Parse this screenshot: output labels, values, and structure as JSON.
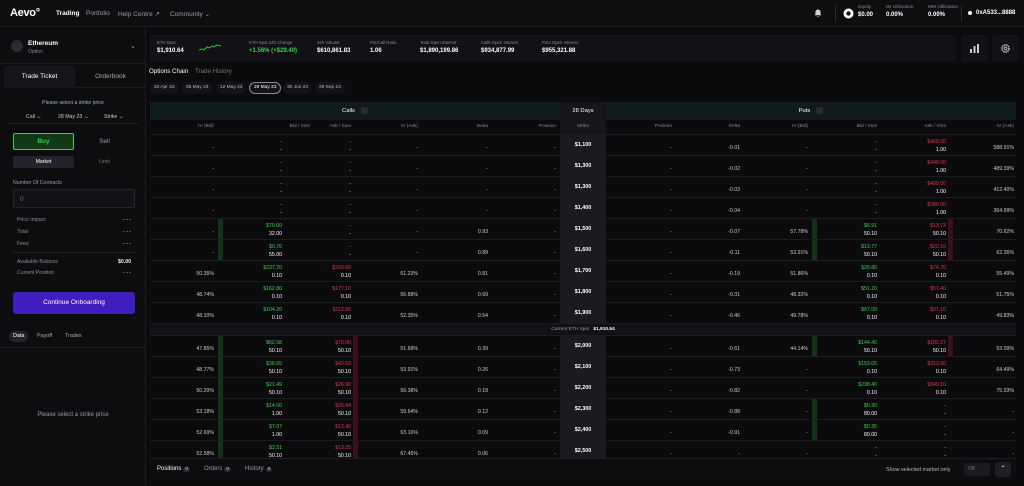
{
  "topnav": {
    "logo": "Aevo°",
    "items": [
      "Trading",
      "Portfolio",
      "Help Centre ↗",
      "Community ⌄"
    ],
    "equity_label": "Equity",
    "equity_value": "$0.00",
    "im_label": "IM Utilization",
    "im_value": "0.00%",
    "mm_label": "MM Utilization",
    "mm_value": "0.00%",
    "wallet": "0xA533...8888"
  },
  "sidebar": {
    "asset_name": "Ethereum",
    "asset_sub": "Option",
    "tab_trade": "Trade Ticket",
    "tab_orderbook": "Orderbook",
    "hint": "Please select a strike price",
    "opt_type": "Call ↔",
    "opt_date": "28 May 23 ↔",
    "opt_strike": "Strike ↔",
    "buy": "Buy",
    "sell": "Sell",
    "market": "Market",
    "limit": "Limit",
    "contracts_label": "Number Of Contracts",
    "contracts_placeholder": "0",
    "price_impact": "Price Impact",
    "price_impact_v": "- - -",
    "total": "Total",
    "total_v": "- - -",
    "fees": "Fees",
    "fees_v": "- - -",
    "avail": "Available Balance",
    "avail_v": "$0.00",
    "curpos": "Current Position",
    "curpos_v": "- - -",
    "cta": "Continue Onboarding",
    "btab1": "Data",
    "btab2": "Payoff",
    "btab3": "Trades",
    "empty": "Please select a strike price"
  },
  "market": {
    "spot_k": "ETH Spot",
    "spot_v": "$1,910.64",
    "chg_k": "ETH Spot 24h Change",
    "chg_v": "+1.56% (+$29.40)",
    "vol_k": "24h Volume",
    "vol_v": "$610,861.83",
    "pc_k": "Put/Call Ratio",
    "pc_v": "1.06",
    "oi_k": "Total Open Interest",
    "oi_v": "$1,890,199.86",
    "coi_k": "Calls Open Interest",
    "coi_v": "$934,877.99",
    "poi_k": "Puts Open Interest",
    "poi_v": "$955,321.88"
  },
  "subtabs": {
    "chain": "Options Chain",
    "history": "Trade History"
  },
  "dates": [
    "20 Apr 23",
    "05 May 23",
    "12 May 23",
    "28 May 23",
    "30 Jun 23",
    "29 Sep 23"
  ],
  "table": {
    "calls": "Calls",
    "days": "28 Days",
    "puts": "Puts",
    "call_cols": [
      "IV (Bid)",
      "Bid / Size",
      "Ask / Size",
      "IV (Ask)",
      "Delta",
      "Position"
    ],
    "strike_col": "Strike",
    "put_cols": [
      "Position",
      "Delta",
      "IV (Bid)",
      "Bid / Size",
      "Ask / Size",
      "IV (Ask)"
    ],
    "separator_label": "Current ETH Spot",
    "separator_value": "$1,910.64",
    "rows": [
      {
        "civb": "-",
        "cbid": "-",
        "cbsz": "-",
        "cask": "-",
        "casz": "-",
        "civa": "-",
        "cdel": "-",
        "cpos": "-",
        "strike": "$1,100",
        "ppos": "-",
        "pdel": "-0.01",
        "pivb": "-",
        "pbid": "-",
        "pbsz": "-",
        "pask": "$469.00",
        "pasz": "1.00",
        "piva": "588.91%"
      },
      {
        "civb": "-",
        "cbid": "-",
        "cbsz": "-",
        "cask": "-",
        "casz": "-",
        "civa": "-",
        "cdel": "-",
        "cpos": "-",
        "strike": "$1,300",
        "ppos": "-",
        "pdel": "-0.02",
        "pivb": "-",
        "pbid": "-",
        "pbsz": "-",
        "pask": "$449.00",
        "pasz": "1.00",
        "piva": "489.39%"
      },
      {
        "civb": "-",
        "cbid": "-",
        "cbsz": "-",
        "cask": "-",
        "casz": "-",
        "civa": "-",
        "cdel": "-",
        "cpos": "-",
        "strike": "$1,300",
        "ppos": "-",
        "pdel": "-0.03",
        "pivb": "-",
        "pbid": "-",
        "pbsz": "-",
        "pask": "$409.00",
        "pasz": "1.00",
        "piva": "412.40%"
      },
      {
        "civb": "-",
        "cbid": "-",
        "cbsz": "-",
        "cask": "-",
        "casz": "-",
        "civa": "-",
        "cdel": "-",
        "cpos": "-",
        "strike": "$1,400",
        "ppos": "-",
        "pdel": "-0.04",
        "pivb": "-",
        "pbid": "-",
        "pbsz": "-",
        "pask": "$389.00",
        "pasz": "1.00",
        "piva": "364.99%"
      },
      {
        "civb": "-",
        "cbid": "$70.00",
        "cbsz": "32.00",
        "cask": "-",
        "casz": "-",
        "civa": "-",
        "cdel": "0.93",
        "cpos": "-",
        "strike": "$1,500",
        "ppos": "-",
        "pdel": "-0.07",
        "pivb": "57.78%",
        "pbid": "$6.91",
        "pbsz": "50.10",
        "pask": "$13.73",
        "pasz": "50.10",
        "piva": "70.62%",
        "cbidbg": true,
        "pbidbg": true,
        "paskbg": true
      },
      {
        "civb": "-",
        "cbid": "$0.76",
        "cbsz": "55.00",
        "cask": "-",
        "casz": "-",
        "civa": "-",
        "cdel": "0.89",
        "cpos": "-",
        "strike": "$1,600",
        "ppos": "-",
        "pdel": "-0.11",
        "pivb": "53.91%",
        "pbid": "$13.77",
        "pbsz": "50.10",
        "pask": "$22.16",
        "pasz": "50.10",
        "piva": "62.36%",
        "cbidbg": true,
        "pbidbg": true,
        "paskbg": true
      },
      {
        "civb": "50.35%",
        "cbid": "$237.20",
        "cbsz": "0.10",
        "cask": "$250.60",
        "casz": "0.10",
        "civa": "61.23%",
        "cdel": "0.81",
        "cpos": "-",
        "strike": "$1,700",
        "ppos": "-",
        "pdel": "-0.19",
        "pivb": "51.86%",
        "pbid": "$28.80",
        "pbsz": "0.10",
        "pask": "$74.70",
        "pasz": "0.10",
        "piva": "55.49%"
      },
      {
        "civb": "48.74%",
        "cbid": "$162.80",
        "cbsz": "0.10",
        "cask": "$177.10",
        "casz": "0.10",
        "civa": "56.88%",
        "cdel": "0.69",
        "cpos": "-",
        "strike": "$1,800",
        "ppos": "-",
        "pdel": "-0.31",
        "pivb": "48.32%",
        "pbid": "$51.20",
        "pbsz": "0.10",
        "pask": "$57.40",
        "pasz": "0.10",
        "piva": "51.75%"
      },
      {
        "civb": "48.10%",
        "cbid": "$104.20",
        "cbsz": "0.10",
        "cask": "$113.80",
        "casz": "0.10",
        "civa": "52.35%",
        "cdel": "0.54",
        "cpos": "-",
        "strike": "$1,900",
        "ppos": "-",
        "pdel": "-0.46",
        "pivb": "49.78%",
        "pbid": "$87.00",
        "pbsz": "0.10",
        "pask": "$97.10",
        "pasz": "0.10",
        "piva": "49.83%"
      },
      {
        "civb": "47.85%",
        "cbid": "$62.58",
        "cbsz": "50.10",
        "cask": "$70.00",
        "casz": "50.10",
        "civa": "51.68%",
        "cdel": "0.39",
        "cpos": "-",
        "strike": "$2,000",
        "ppos": "-",
        "pdel": "-0.61",
        "pivb": "44.14%",
        "pbid": "$144.45",
        "pbsz": "50.10",
        "pask": "$182.27",
        "pasz": "50.10",
        "piva": "53.09%",
        "cbidbg": true,
        "caskbg": true,
        "pbidbg": true,
        "paskbg": true
      },
      {
        "civb": "48.77%",
        "cbid": "$38.65",
        "cbsz": "50.10",
        "cask": "$43.63",
        "casz": "50.10",
        "civa": "53.91%",
        "cdel": "0.26",
        "cpos": "-",
        "strike": "$2,100",
        "ppos": "-",
        "pdel": "-0.73",
        "pivb": "-",
        "pbid": "$153.05",
        "pbsz": "0.10",
        "pask": "$313.90",
        "pasz": "0.10",
        "piva": "64.49%",
        "cbidbg": true,
        "caskbg": true
      },
      {
        "civb": "50.20%",
        "cbid": "$21.49",
        "cbsz": "50.10",
        "cask": "$26.90",
        "casz": "50.10",
        "civa": "56.38%",
        "cdel": "0.18",
        "cpos": "-",
        "strike": "$2,200",
        "ppos": "-",
        "pdel": "-0.82",
        "pivb": "-",
        "pbid": "$238.40",
        "pbsz": "0.10",
        "pask": "$349.10",
        "pasz": "0.10",
        "piva": "75.03%",
        "cbidbg": true,
        "caskbg": true
      },
      {
        "civb": "53.18%",
        "cbid": "$14.00",
        "cbsz": "1.00",
        "cask": "$20.84",
        "casz": "50.10",
        "civa": "59.64%",
        "cdel": "0.12",
        "cpos": "-",
        "strike": "$2,300",
        "ppos": "-",
        "pdel": "-0.88",
        "pivb": "-",
        "pbid": "$0.30",
        "pbsz": "80.00",
        "pask": "-",
        "pasz": "-",
        "piva": "-",
        "cbidbg": true,
        "caskbg": true,
        "pbidbg": true
      },
      {
        "civb": "52.69%",
        "cbid": "$7.07",
        "cbsz": "1.00",
        "cask": "$13.40",
        "casz": "50.10",
        "civa": "63.16%",
        "cdel": "0.09",
        "cpos": "-",
        "strike": "$2,400",
        "ppos": "-",
        "pdel": "-0.91",
        "pivb": "-",
        "pbid": "$0.35",
        "pbsz": "80.00",
        "pask": "-",
        "pasz": "-",
        "piva": "-",
        "cbidbg": true,
        "caskbg": true,
        "pbidbg": true
      },
      {
        "civb": "52.58%",
        "cbid": "$3.51",
        "cbsz": "50.10",
        "cask": "$13.25",
        "casz": "50.10",
        "civa": "67.45%",
        "cdel": "0.06",
        "cpos": "-",
        "strike": "$2,500",
        "ppos": "-",
        "pdel": "-",
        "pivb": "-",
        "pbid": "-",
        "pbsz": "-",
        "pask": "-",
        "pasz": "-",
        "piva": "-",
        "cbidbg": true,
        "caskbg": true
      }
    ]
  },
  "bottom": {
    "positions": "Positions",
    "positions_n": "0",
    "orders": "Orders",
    "orders_n": "0",
    "history": "History",
    "history_n": "0",
    "show_selected": "Show selected market only",
    "toggle": "Off"
  }
}
